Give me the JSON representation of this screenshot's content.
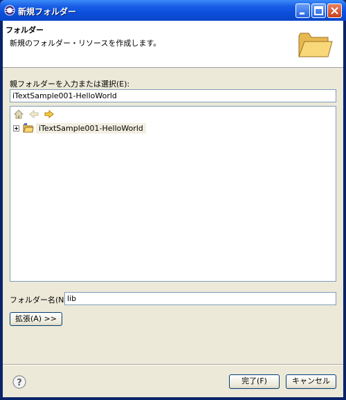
{
  "window": {
    "title": "新規フォルダー",
    "accent": "#0b4fdc"
  },
  "header": {
    "title": "フォルダー",
    "description": "新規のフォルダー・リソースを作成します。",
    "image_icon": "folder-open-icon"
  },
  "parent": {
    "label": "親フォルダーを入力または選択(E):",
    "value": "iTextSample001-HelloWorld"
  },
  "tree": {
    "toolbar_icons": [
      "home-icon",
      "back-arrow-icon",
      "forward-arrow-icon"
    ],
    "items": [
      {
        "label": "iTextSample001-HelloWorld",
        "icon": "project-folder-icon",
        "expanded": false
      }
    ]
  },
  "folder_name": {
    "label": "フォルダー名(N):",
    "value": "lib"
  },
  "advanced_button": "拡張(A) >>",
  "footer": {
    "finish_label": "完了(F)",
    "cancel_label": "キャンセル",
    "help_icon": "help-icon"
  }
}
